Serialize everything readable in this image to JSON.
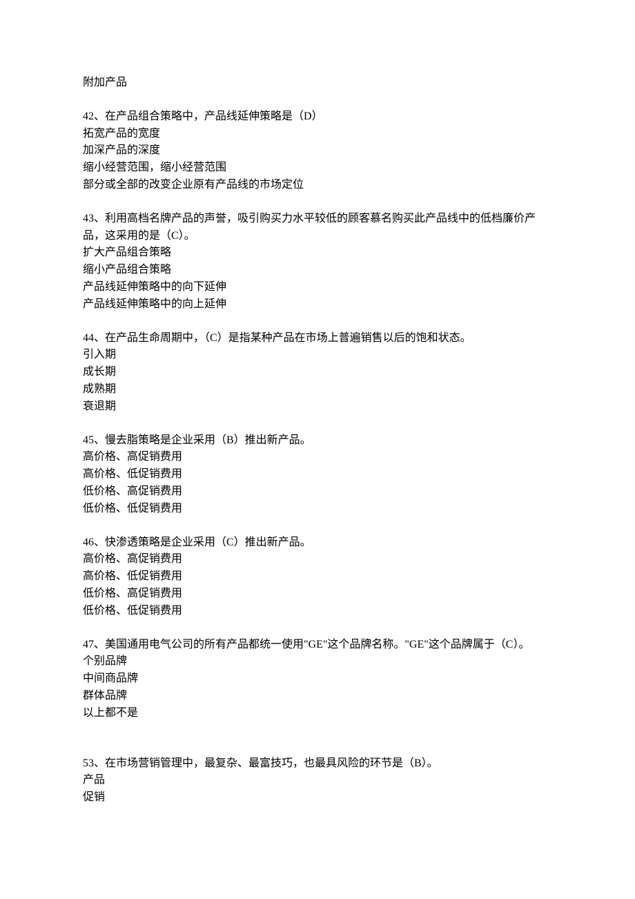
{
  "prelude": "附加产品",
  "questions": [
    {
      "stem": "42、在产品组合策略中，产品线延伸策略是（D）",
      "options": [
        "拓宽产品的宽度",
        "加深产品的深度",
        "缩小经营范围，缩小经营范围",
        "部分或全部的改变企业原有产品线的市场定位"
      ]
    },
    {
      "stem": "43、利用高档名牌产品的声誉，吸引购买力水平较低的顾客慕名购买此产品线中的低档廉价产品，这采用的是（C）。",
      "options": [
        "扩大产品组合策略",
        "缩小产品组合策略",
        "产品线延伸策略中的向下延伸",
        "产品线延伸策略中的向上延伸"
      ]
    },
    {
      "stem": "44、在产品生命周期中，（C）是指某种产品在市场上普遍销售以后的饱和状态。",
      "options": [
        "引入期",
        "成长期",
        "成熟期",
        "衰退期"
      ]
    },
    {
      "stem": "45、慢去脂策略是企业采用（B）推出新产品。",
      "options": [
        "高价格、高促销费用",
        "高价格、低促销费用",
        "低价格、高促销费用",
        "低价格、低促销费用"
      ]
    },
    {
      "stem": "46、快渗透策略是企业采用（C）推出新产品。",
      "options": [
        "高价格、高促销费用",
        "高价格、低促销费用",
        "低价格、高促销费用",
        "低价格、低促销费用"
      ]
    },
    {
      "stem": "47、美国通用电气公司的所有产品都统一使用\"GE\"这个品牌名称。\"GE\"这个品牌属于（C）。",
      "options": [
        "个别品牌",
        "中间商品牌",
        "群体品牌",
        "以上都不是"
      ]
    },
    {
      "stem": "53、在市场营销管理中，最复杂、最富技巧，也最具风险的环节是（B）。",
      "options": [
        "产品",
        "促销"
      ]
    }
  ]
}
